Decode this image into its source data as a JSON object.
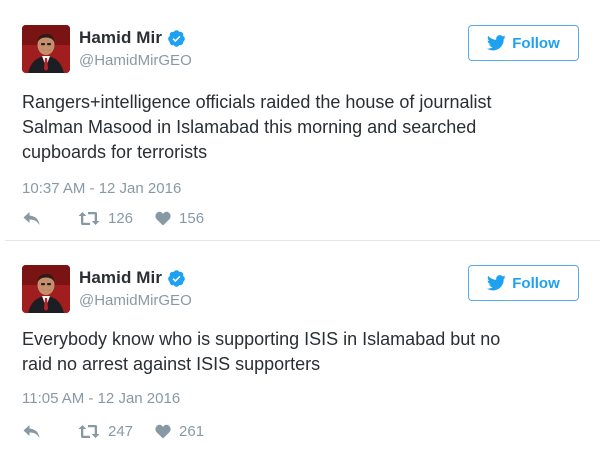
{
  "tweets": [
    {
      "author": {
        "name": "Hamid Mir",
        "handle": "@HamidMirGEO",
        "verified": true
      },
      "follow_label": "Follow",
      "text_lines": [
        "Rangers+intelligence officials raided the house of journalist",
        "Salman Masood in Islamabad this morning and searched",
        "cupboards for terrorists"
      ],
      "timestamp": "10:37 AM - 12 Jan 2016",
      "retweets": "126",
      "likes": "156"
    },
    {
      "author": {
        "name": "Hamid Mir",
        "handle": "@HamidMirGEO",
        "verified": true
      },
      "follow_label": "Follow",
      "text_lines": [
        "Everybody know who is supporting ISIS in Islamabad but no",
        "raid no arrest against ISIS supporters"
      ],
      "timestamp": "11:05 AM - 12 Jan 2016",
      "retweets": "247",
      "likes": "261"
    }
  ],
  "icons": {
    "verified": "verified-badge-icon",
    "follow": "twitter-bird-icon",
    "reply": "reply-icon",
    "retweet": "retweet-icon",
    "like": "heart-icon"
  },
  "colors": {
    "accent": "#1da1f2",
    "verified": "#1da1f2",
    "muted": "#8899a6",
    "text": "#292f33",
    "border": "#e1e8ed"
  }
}
